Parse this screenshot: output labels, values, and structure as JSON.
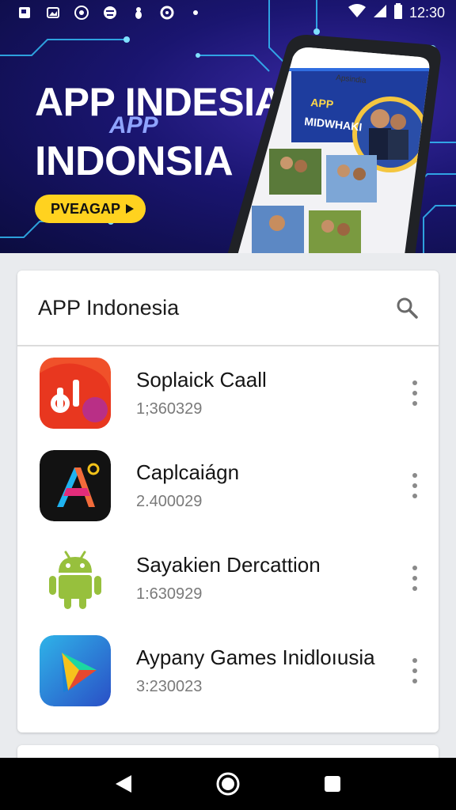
{
  "status_bar": {
    "time": "12:30"
  },
  "hero": {
    "title_line1": "APP INDESIA",
    "title_accent": "APP",
    "title_line2": "INDONSIA",
    "cta_label": "PVEAGAP",
    "phone_screen": {
      "header_text": "Apsindia",
      "promo_title": "APP",
      "promo_subtitle": "MIDWHAKI"
    }
  },
  "card": {
    "title": "APP Indonesia",
    "apps": [
      {
        "name": "Soplaick Caall",
        "subtitle": "1;360329",
        "icon": "orange-red-logo-icon"
      },
      {
        "name": "Caplcaiágn",
        "subtitle": "2.400029",
        "icon": "colorful-a-logo-icon"
      },
      {
        "name": "Sayakien Dercattion",
        "subtitle": "1:630929",
        "icon": "android-robot-icon"
      },
      {
        "name": "Aypany Games Inidloıusia",
        "subtitle": "3:230023",
        "icon": "play-triangle-icon"
      }
    ]
  },
  "colors": {
    "hero_bg": "#1a1570",
    "cta_yellow": "#ffd21f",
    "card_bg": "#ffffff",
    "page_bg": "#e9ebee"
  }
}
